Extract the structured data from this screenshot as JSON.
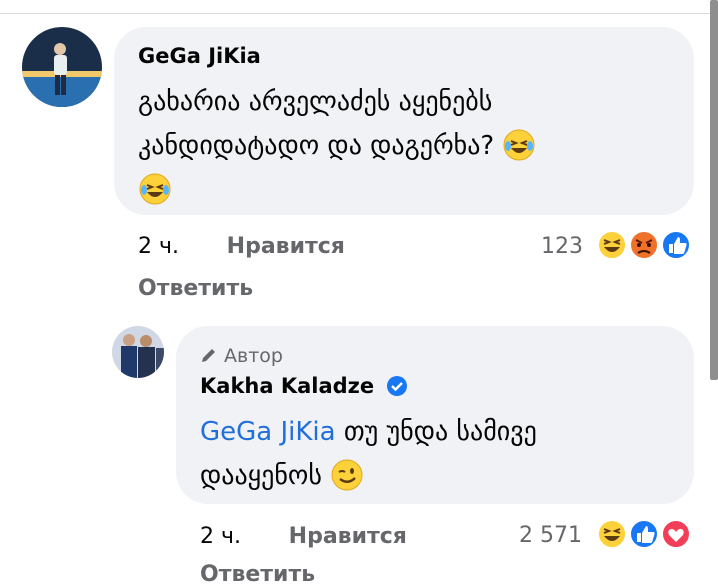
{
  "comments": [
    {
      "author": "GeGa JiKia",
      "text_line1": "გახარია არველაძეს აყენებს",
      "text_line2": "კანდიდატადო და დაგერხა?",
      "time": "2 ч.",
      "like_label": "Нравится",
      "reply_label": "Ответить",
      "reaction_count": "123",
      "reactions": [
        "haha-reaction-icon",
        "angry-reaction-icon",
        "like-reaction-icon"
      ]
    },
    {
      "badge": "Автор",
      "author": "Kakha Kaladze",
      "mention": "GeGa JiKia",
      "text_rest": "თუ უნდა სამივე",
      "text_line2": "დააყენოს",
      "time": "2 ч.",
      "like_label": "Нравится",
      "reply_label": "Ответить",
      "reaction_count": "2 571",
      "reactions": [
        "haha-reaction-icon",
        "like-reaction-icon",
        "love-reaction-icon"
      ]
    }
  ],
  "colors": {
    "bubble": "#f0f2f5",
    "link": "#216fdb",
    "secondary_text": "#65676b",
    "verified": "#1877f2"
  }
}
